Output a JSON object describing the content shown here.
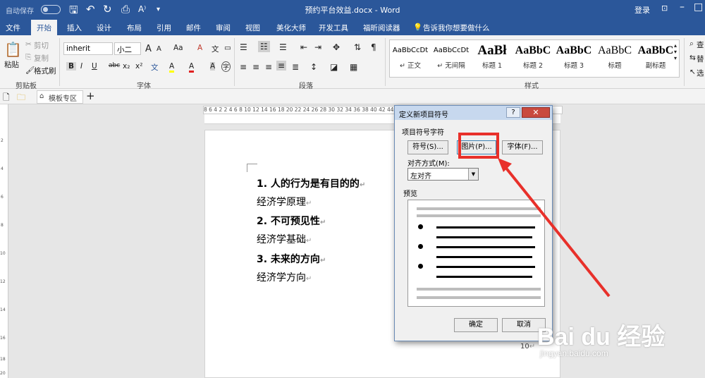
{
  "titlebar": {
    "autosave": "自动保存",
    "title": "预约平台效益.docx - Word",
    "login": "登录",
    "qat_icons": [
      "save-icon",
      "undo-icon",
      "redo-icon",
      "print-preview-icon",
      "text-size-icon"
    ],
    "win_controls": [
      "ribbon-display",
      "minimize",
      "restore",
      "close"
    ]
  },
  "tabs": [
    "文件",
    "开始",
    "插入",
    "设计",
    "布局",
    "引用",
    "邮件",
    "审阅",
    "视图",
    "美化大师",
    "开发工具",
    "福昕阅读器",
    "告诉我你想要做什么"
  ],
  "ribbon": {
    "clipboard": {
      "paste": "粘贴",
      "cut": "剪切",
      "copy": "复制",
      "format_painter": "格式刷",
      "label": "剪贴板"
    },
    "font": {
      "family": "inherit",
      "size": "小二",
      "label": "字体",
      "grow": "A",
      "shrink": "A",
      "case": "Aa",
      "clear": "A",
      "wen": "文",
      "font_color_a": "A",
      "highlight_a": "A",
      "shade_a": "A",
      "enclose": "字"
    },
    "format_buttons": [
      "B",
      "I",
      "U",
      "abc",
      "x₂",
      "x²"
    ],
    "paragraph": {
      "label": "段落"
    },
    "styles": {
      "label": "样式",
      "items": [
        {
          "sample": "AaBbCcDt",
          "name": "↵ 正文"
        },
        {
          "sample": "AaBbCcDt",
          "name": "↵ 无间隔"
        },
        {
          "sample": "AaBł",
          "name": "标题 1"
        },
        {
          "sample": "AaBbC",
          "name": "标题 2"
        },
        {
          "sample": "AaBbC",
          "name": "标题 3"
        },
        {
          "sample": "AaBbC",
          "name": "标题"
        },
        {
          "sample": "AaBbC",
          "name": "副标题"
        }
      ]
    },
    "edit": {
      "find": "查",
      "replace": "替",
      "select": "选"
    }
  },
  "docbar": {
    "tab_label": "模板专区",
    "add": "+"
  },
  "hruler": {
    "ticks": "8   6   4   2       2   4   6   8   10   12   14   16   18   20   22   24   26   28   30   32   34   36   38   40   42   44   46   48"
  },
  "vruler": {
    "ticks": [
      "2",
      "4",
      "6",
      "8",
      "10",
      "12",
      "14",
      "16",
      "18",
      "20"
    ]
  },
  "document": {
    "lines": [
      {
        "text": "1. 人的行为是有目的的",
        "style": "h"
      },
      {
        "text": "经济学原理",
        "style": "t"
      },
      {
        "text": "2. 不可预见性",
        "style": "h"
      },
      {
        "text": "经济学基础",
        "style": "t"
      },
      {
        "text": "3. 未来的方向",
        "style": "h"
      },
      {
        "text": "经济学方向",
        "style": "t"
      }
    ],
    "para_mark": "↵",
    "page_number": "10"
  },
  "dialog": {
    "title": "定义新项目符号",
    "help": "?",
    "close": "✕",
    "section_symbol": "项目符号字符",
    "symbol_button": "符号(S)...",
    "picture_button": "图片(P)...",
    "font_button": "字体(F)...",
    "alignment_label": "对齐方式(M):",
    "alignment_value": "左对齐",
    "preview_label": "预览",
    "ok": "确定",
    "cancel": "取消"
  },
  "watermark": {
    "brand": "Bai du 经验",
    "url": "jingyan.baidu.com"
  },
  "colors": {
    "accent": "#2b579a",
    "highlight": "#e8302a"
  }
}
